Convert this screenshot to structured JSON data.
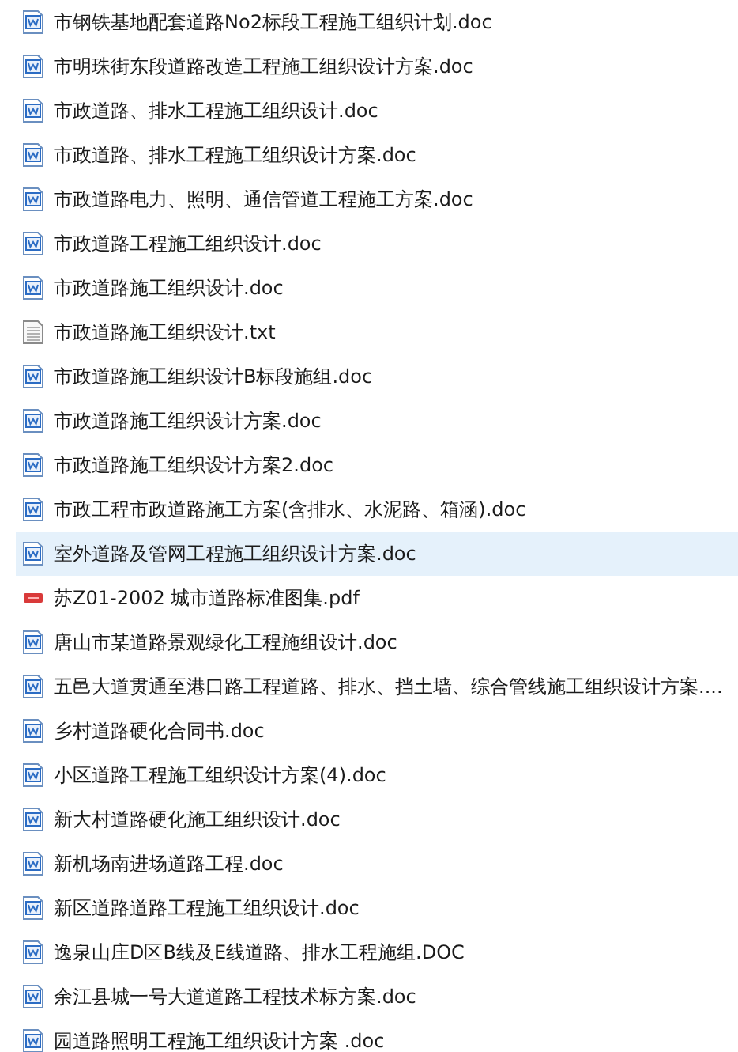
{
  "files": [
    {
      "name": "市钢铁基地配套道路No2标段工程施工组织计划.doc",
      "kind": "doc",
      "selected": false
    },
    {
      "name": "市明珠街东段道路改造工程施工组织设计方案.doc",
      "kind": "doc",
      "selected": false
    },
    {
      "name": "市政道路、排水工程施工组织设计.doc",
      "kind": "doc",
      "selected": false
    },
    {
      "name": "市政道路、排水工程施工组织设计方案.doc",
      "kind": "doc",
      "selected": false
    },
    {
      "name": "市政道路电力、照明、通信管道工程施工方案.doc",
      "kind": "doc",
      "selected": false
    },
    {
      "name": "市政道路工程施工组织设计.doc",
      "kind": "doc",
      "selected": false
    },
    {
      "name": "市政道路施工组织设计.doc",
      "kind": "doc",
      "selected": false
    },
    {
      "name": "市政道路施工组织设计.txt",
      "kind": "txt",
      "selected": false
    },
    {
      "name": "市政道路施工组织设计B标段施组.doc",
      "kind": "doc",
      "selected": false
    },
    {
      "name": "市政道路施工组织设计方案.doc",
      "kind": "doc",
      "selected": false
    },
    {
      "name": "市政道路施工组织设计方案2.doc",
      "kind": "doc",
      "selected": false
    },
    {
      "name": "市政工程市政道路施工方案(含排水、水泥路、箱涵).doc",
      "kind": "doc",
      "selected": false
    },
    {
      "name": "室外道路及管网工程施工组织设计方案.doc",
      "kind": "doc",
      "selected": true
    },
    {
      "name": "苏Z01-2002 城市道路标准图集.pdf",
      "kind": "pdf",
      "selected": false
    },
    {
      "name": "唐山市某道路景观绿化工程施组设计.doc",
      "kind": "doc",
      "selected": false
    },
    {
      "name": "五邑大道贯通至港口路工程道路、排水、挡土墙、综合管线施工组织设计方案....",
      "kind": "doc",
      "selected": false
    },
    {
      "name": "乡村道路硬化合同书.doc",
      "kind": "doc",
      "selected": false
    },
    {
      "name": "小区道路工程施工组织设计方案(4).doc",
      "kind": "doc",
      "selected": false
    },
    {
      "name": "新大村道路硬化施工组织设计.doc",
      "kind": "doc",
      "selected": false
    },
    {
      "name": "新机场南进场道路工程.doc",
      "kind": "doc",
      "selected": false
    },
    {
      "name": "新区道路道路工程施工组织设计.doc",
      "kind": "doc",
      "selected": false
    },
    {
      "name": "逸泉山庄D区B线及E线道路、排水工程施组.DOC",
      "kind": "doc",
      "selected": false
    },
    {
      "name": "余江县城一号大道道路工程技术标方案.doc",
      "kind": "doc",
      "selected": false
    },
    {
      "name": "园道路照明工程施工组织设计方案 .doc",
      "kind": "doc",
      "selected": false
    }
  ]
}
